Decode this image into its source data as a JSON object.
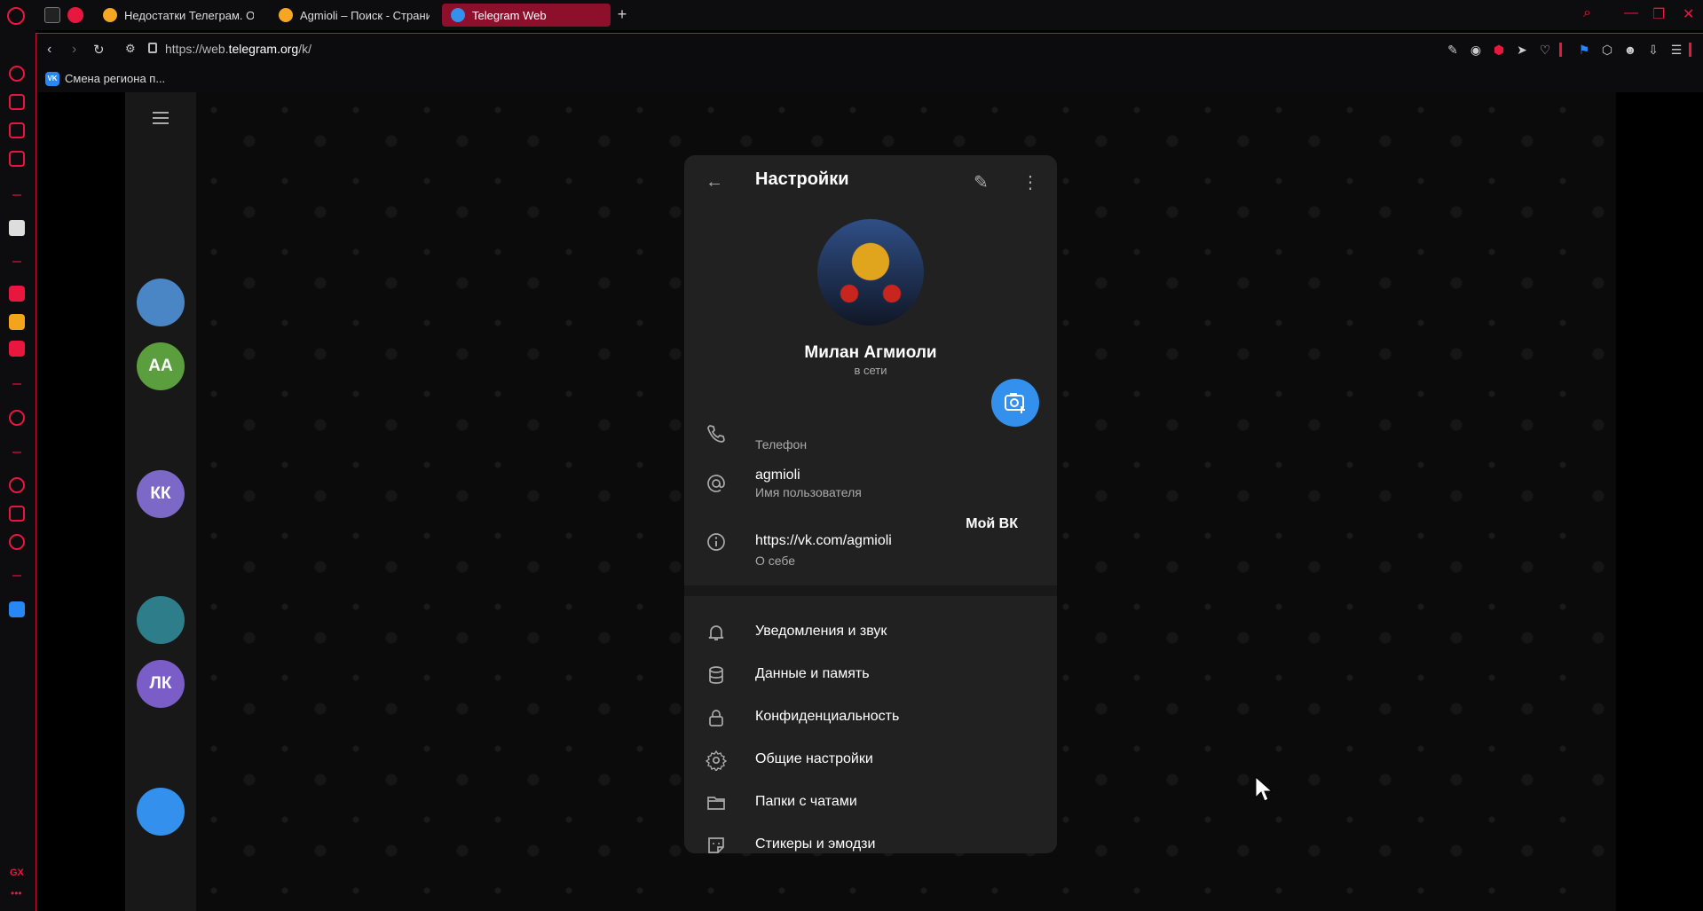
{
  "browser": {
    "tabs": [
      {
        "label": "Недостатки Телеграм. От",
        "active": false
      },
      {
        "label": "Agmioli – Поиск - Страниц",
        "active": false
      },
      {
        "label": "Telegram Web",
        "active": true
      }
    ],
    "url_prefix": "https://web.",
    "url_domain": "telegram.org",
    "url_suffix": "/k/",
    "bookmarks": [
      {
        "label": "Смена региона п...",
        "icon_text": "VK"
      }
    ],
    "sidebar_bottom_label": "GX",
    "accent_color": "#e8173f"
  },
  "telegram": {
    "chat_avatars": [
      {
        "initials": "",
        "color": "#4a86c5"
      },
      {
        "initials": "АА",
        "color": "#5a9e3e"
      },
      {
        "initials": "КК",
        "color": "#7b68c7"
      },
      {
        "initials": "",
        "color": "#2e7d8a"
      },
      {
        "initials": "ЛК",
        "color": "#7b5dc7"
      },
      {
        "initials": "",
        "color": "#3390ec"
      }
    ],
    "settings": {
      "title": "Настройки",
      "profile_name": "Милан Агмиоли",
      "profile_status": "в сети",
      "info": [
        {
          "icon": "phone-icon",
          "value": "",
          "label": "Телефон",
          "aside": ""
        },
        {
          "icon": "at-icon",
          "value": "agmioli",
          "label": "Имя пользователя",
          "aside": ""
        },
        {
          "icon": "info-icon",
          "value": "https://vk.com/agmioli",
          "label": "О себе",
          "aside": "Мой ВК"
        }
      ],
      "menu": [
        {
          "icon": "bell-icon",
          "label": "Уведомления и звук"
        },
        {
          "icon": "database-icon",
          "label": "Данные и память"
        },
        {
          "icon": "lock-icon",
          "label": "Конфиденциальность"
        },
        {
          "icon": "gear-icon",
          "label": "Общие настройки"
        },
        {
          "icon": "folder-icon",
          "label": "Папки с чатами"
        },
        {
          "icon": "sticker-icon",
          "label": "Стикеры и эмодзи"
        }
      ],
      "accent_color": "#3390ec"
    }
  }
}
